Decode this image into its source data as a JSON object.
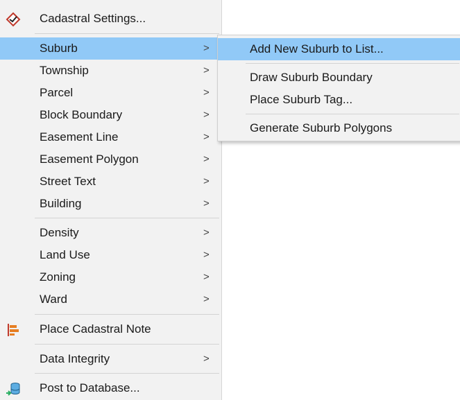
{
  "menu": {
    "items": [
      {
        "label": "Cadastral Settings...",
        "icon": "cadastral-settings-icon"
      },
      {
        "label": "Suburb",
        "arrow": ">"
      },
      {
        "label": "Township",
        "arrow": ">"
      },
      {
        "label": "Parcel",
        "arrow": ">"
      },
      {
        "label": "Block Boundary",
        "arrow": ">"
      },
      {
        "label": "Easement Line",
        "arrow": ">"
      },
      {
        "label": "Easement Polygon",
        "arrow": ">"
      },
      {
        "label": "Street Text",
        "arrow": ">"
      },
      {
        "label": "Building",
        "arrow": ">"
      },
      {
        "label": "Density",
        "arrow": ">"
      },
      {
        "label": "Land Use",
        "arrow": ">"
      },
      {
        "label": "Zoning",
        "arrow": ">"
      },
      {
        "label": "Ward",
        "arrow": ">"
      },
      {
        "label": "Place Cadastral Note",
        "icon": "cadastral-note-icon"
      },
      {
        "label": "Data Integrity",
        "arrow": ">"
      },
      {
        "label": "Post to Database...",
        "icon": "post-to-database-icon"
      }
    ]
  },
  "submenu": {
    "items": [
      {
        "label": "Add New Suburb to List..."
      },
      {
        "label": "Draw Suburb Boundary"
      },
      {
        "label": "Place Suburb Tag..."
      },
      {
        "label": "Generate Suburb Polygons"
      }
    ]
  },
  "colors": {
    "menu_background": "#f2f2f2",
    "highlight": "#91c9f7",
    "separator": "#d3d3d3"
  }
}
